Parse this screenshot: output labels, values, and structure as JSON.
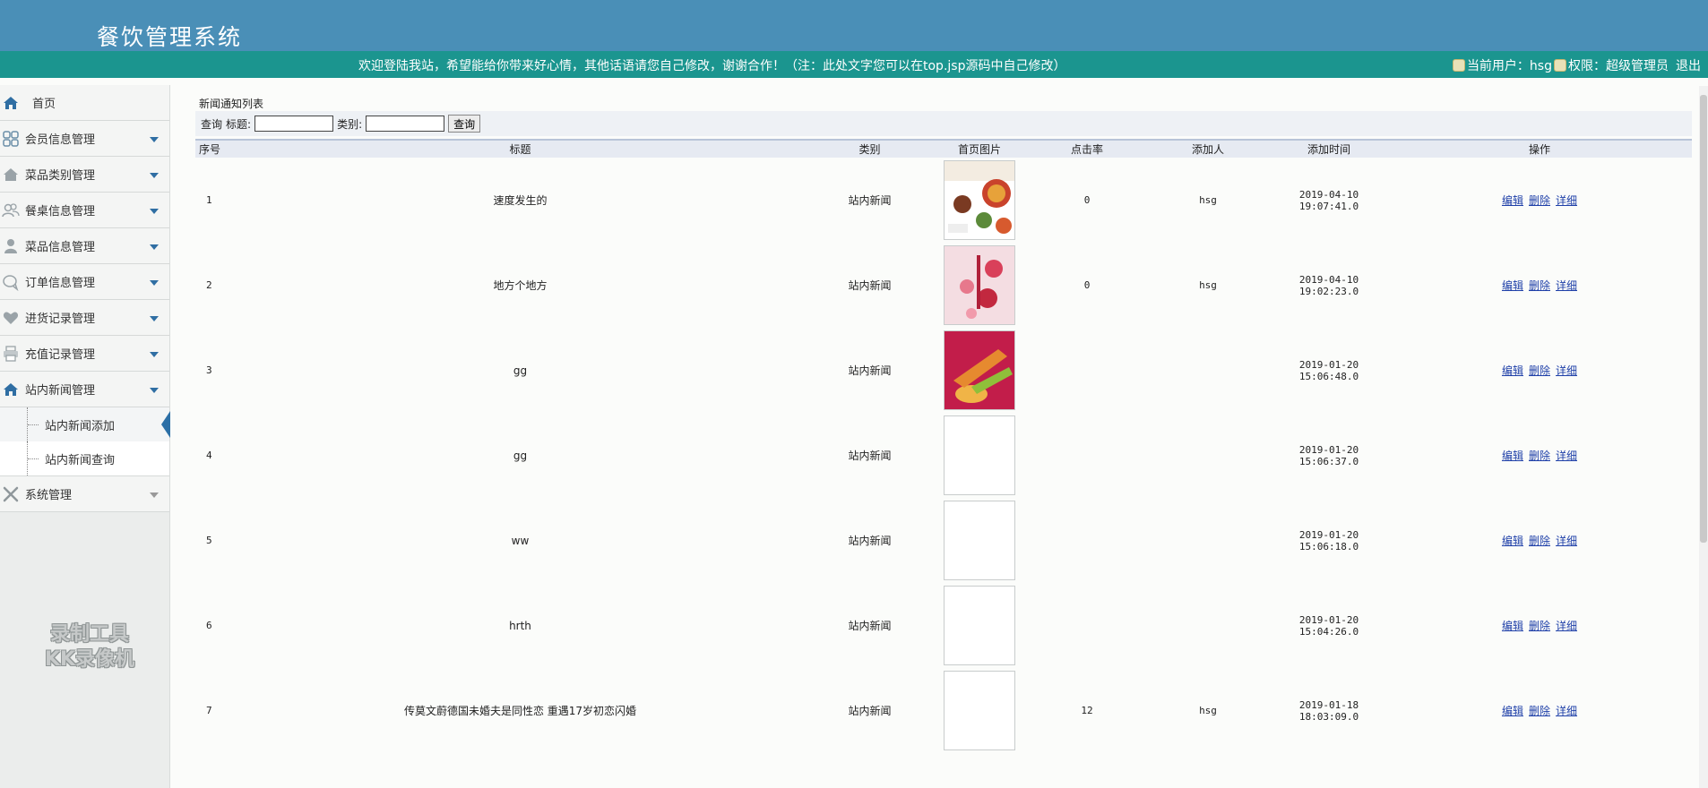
{
  "header": {
    "title": "餐饮管理系统",
    "welcome": "欢迎登陆我站，希望能给你带来好心情，其他话语请您自己修改，谢谢合作！（注：此处文字您可以在top.jsp源码中自己修改）",
    "current_user": "当前用户：hsg",
    "role": "权限：超级管理员",
    "logout": "退出"
  },
  "sidebar": {
    "home": "首页",
    "items": [
      {
        "label": "会员信息管理",
        "icon": "grid-icon"
      },
      {
        "label": "菜品类别管理",
        "icon": "home-icon"
      },
      {
        "label": "餐桌信息管理",
        "icon": "users-icon"
      },
      {
        "label": "菜品信息管理",
        "icon": "user-icon"
      },
      {
        "label": "订单信息管理",
        "icon": "chat-icon"
      },
      {
        "label": "进货记录管理",
        "icon": "heart-icon"
      },
      {
        "label": "充值记录管理",
        "icon": "printer-icon"
      },
      {
        "label": "站内新闻管理",
        "icon": "home-icon"
      }
    ],
    "sub_items": [
      "站内新闻添加",
      "站内新闻查询"
    ],
    "system": "系统管理",
    "watermark_line1": "录制工具",
    "watermark_line2": "KK录像机"
  },
  "main": {
    "page_title": "新闻通知列表",
    "search": {
      "prefix": "查询",
      "title_label": "标题:",
      "type_label": "类别:",
      "button": "查询"
    },
    "columns": [
      "序号",
      "标题",
      "类别",
      "首页图片",
      "点击率",
      "添加人",
      "添加时间",
      "操作"
    ],
    "ops": [
      "编辑",
      "删除",
      "详细"
    ],
    "rows": [
      {
        "id": "1",
        "title": "速度发生的",
        "type": "站内新闻",
        "img": "food",
        "clicks": "0",
        "author": "hsg",
        "time": "2019-04-10 19:07:41.0"
      },
      {
        "id": "2",
        "title": "地方个地方",
        "type": "站内新闻",
        "img": "pink",
        "clicks": "0",
        "author": "hsg",
        "time": "2019-04-10 19:02:23.0"
      },
      {
        "id": "3",
        "title": "gg",
        "type": "站内新闻",
        "img": "red",
        "clicks": "",
        "author": "",
        "time": "2019-01-20 15:06:48.0"
      },
      {
        "id": "4",
        "title": "gg",
        "type": "站内新闻",
        "img": "blank",
        "clicks": "",
        "author": "",
        "time": "2019-01-20 15:06:37.0"
      },
      {
        "id": "5",
        "title": "ww",
        "type": "站内新闻",
        "img": "blank",
        "clicks": "",
        "author": "",
        "time": "2019-01-20 15:06:18.0"
      },
      {
        "id": "6",
        "title": "hrth",
        "type": "站内新闻",
        "img": "blank",
        "clicks": "",
        "author": "",
        "time": "2019-01-20 15:04:26.0"
      },
      {
        "id": "7",
        "title": "传莫文蔚德国未婚夫是同性恋 重遇17岁初恋闪婚",
        "type": "站内新闻",
        "img": "blank",
        "clicks": "12",
        "author": "hsg",
        "time": "2019-01-18 18:03:09.0"
      }
    ]
  }
}
